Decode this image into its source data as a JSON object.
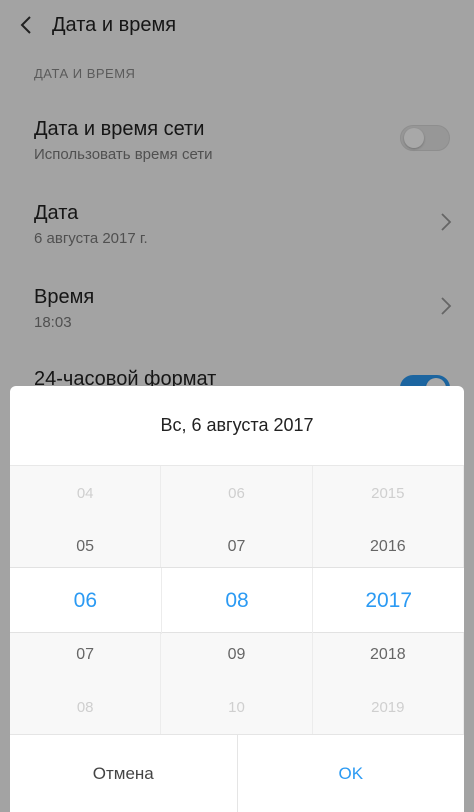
{
  "header": {
    "title": "Дата и время"
  },
  "section": {
    "title": "ДАТА И ВРЕМЯ"
  },
  "rows": [
    {
      "title": "Дата и время сети",
      "subtitle": "Использовать время сети",
      "control": "toggle",
      "state": "off"
    },
    {
      "title": "Дата",
      "subtitle": "6 августа 2017 г.",
      "control": "chevron"
    },
    {
      "title": "Время",
      "subtitle": "18:03",
      "control": "chevron"
    },
    {
      "title": "24-часовой формат",
      "control": "toggle",
      "state": "on"
    }
  ],
  "dialog": {
    "title": "Вс, 6 августа 2017",
    "day_column": [
      "04",
      "05",
      "06",
      "07",
      "08"
    ],
    "month_column": [
      "06",
      "07",
      "08",
      "09",
      "10"
    ],
    "year_column": [
      "2015",
      "2016",
      "2017",
      "2018",
      "2019"
    ],
    "selected": {
      "day": "06",
      "month": "08",
      "year": "2017"
    },
    "cancel_label": "Отмена",
    "ok_label": "OK"
  },
  "colors": {
    "accent": "#2b9af3",
    "background": "#f7f7f7",
    "dim_overlay": "rgba(0,0,0,0.34)"
  },
  "icons": {
    "back": "back-chevron-icon",
    "row_arrow": "chevron-right-icon"
  }
}
